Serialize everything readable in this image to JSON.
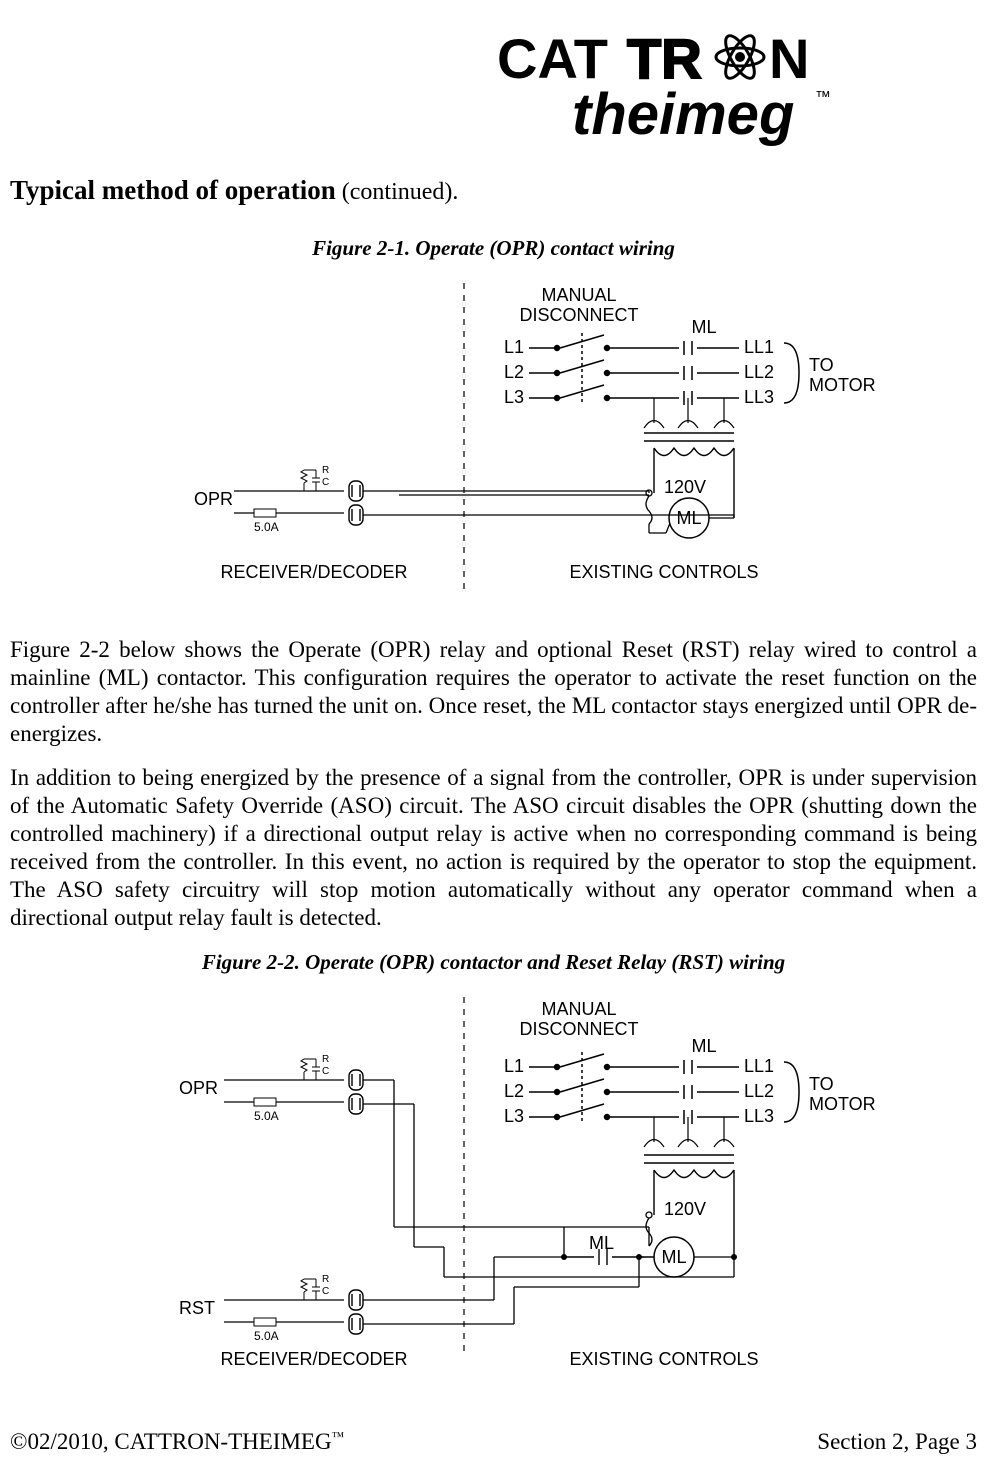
{
  "logo": {
    "line1_bold": "CAT",
    "line1_outline": "TR",
    "line1_symbol": "N",
    "line2": "theimeg",
    "tm": "™"
  },
  "heading": {
    "title": "Typical method of operation",
    "continued": " (continued)"
  },
  "fig1": {
    "caption": "Figure 2-1.  Operate (OPR) contact wiring",
    "labels": {
      "manual_disconnect": "MANUAL\nDISCONNECT",
      "L1": "L1",
      "L2": "L2",
      "L3": "L3",
      "ML": "ML",
      "LL1": "LL1",
      "LL2": "LL2",
      "LL3": "LL3",
      "to_motor": "TO\nMOTOR",
      "v120": "120V",
      "ML_coil": "ML",
      "OPR": "OPR",
      "fuse": "5.0A",
      "R": "R",
      "C": "C",
      "left_section": "RECEIVER/DECODER",
      "right_section": "EXISTING CONTROLS"
    }
  },
  "para1": "Figure 2-2 below shows the Operate (OPR) relay and optional Reset (RST) relay wired to control a mainline (ML) contactor. This configuration requires the operator to activate the reset function on the controller after he/she has turned the unit on.  Once reset, the ML contactor stays energized until OPR de-energizes.",
  "para2": "In addition to being energized by the presence of a signal from the controller, OPR is under supervision of the Automatic Safety Override (ASO) circuit. The ASO circuit disables the OPR (shutting down the controlled machinery) if a directional output relay is active when no corresponding command is being received from the controller.  In this event, no action is required by the operator to stop the equipment. The ASO safety circuitry will stop motion automatically without any operator command when a directional output relay fault is detected.",
  "fig2": {
    "caption": "Figure 2-2.  Operate (OPR) contactor and Reset Relay (RST) wiring",
    "labels": {
      "manual_disconnect": "MANUAL\nDISCONNECT",
      "L1": "L1",
      "L2": "L2",
      "L3": "L3",
      "ML": "ML",
      "LL1": "LL1",
      "LL2": "LL2",
      "LL3": "LL3",
      "to_motor": "TO\nMOTOR",
      "v120": "120V",
      "ML_contact": "ML",
      "ML_coil": "ML",
      "OPR": "OPR",
      "RST": "RST",
      "fuse": "5.0A",
      "R": "R",
      "C": "C",
      "left_section": "RECEIVER/DECODER",
      "right_section": "EXISTING CONTROLS"
    }
  },
  "footer": {
    "copyright_pre": "©02/2010, CATTRON-THEIMEG",
    "tm": "™",
    "page": "Section 2, Page 3"
  }
}
